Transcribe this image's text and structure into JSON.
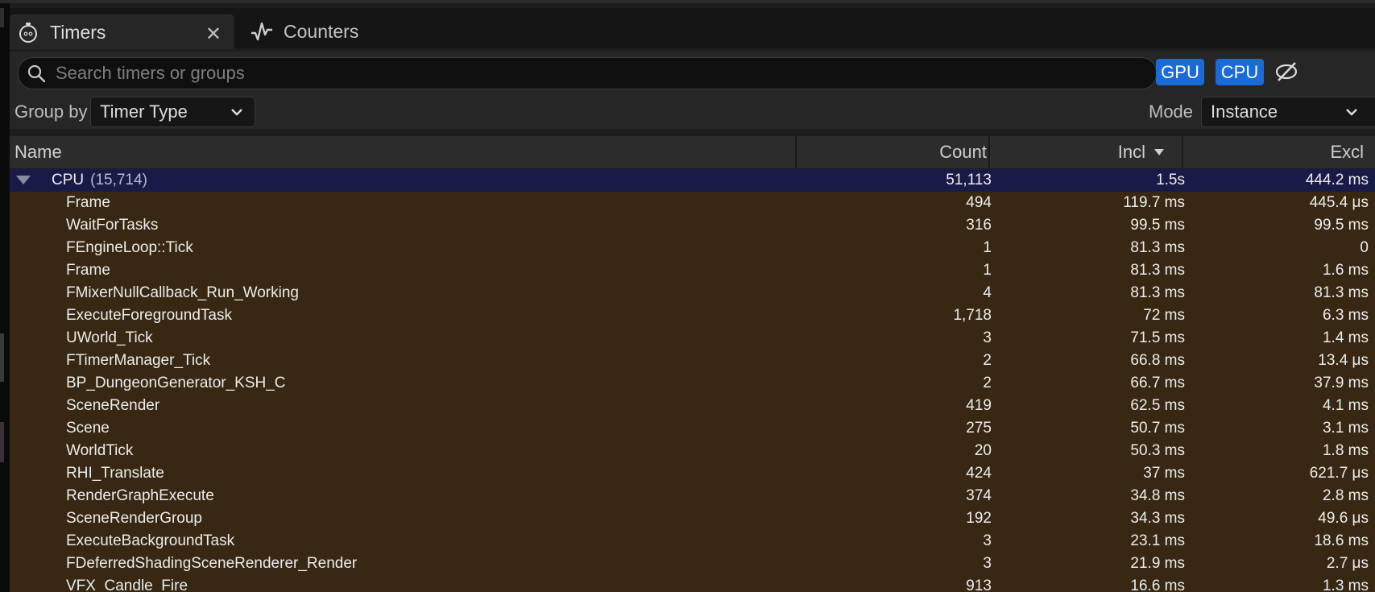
{
  "tabs": [
    {
      "label": "Timers",
      "icon": "stopwatch-icon",
      "active": true
    },
    {
      "label": "Counters",
      "icon": "pulse-icon",
      "active": false
    }
  ],
  "search": {
    "placeholder": "Search timers or groups",
    "value": ""
  },
  "filters": {
    "gpu_label": "GPU",
    "cpu_label": "CPU",
    "accent": "#1a6ad8"
  },
  "group_by": {
    "label": "Group by",
    "value": "Timer Type"
  },
  "mode": {
    "label": "Mode",
    "value": "Instance"
  },
  "columns": {
    "name": "Name",
    "count": "Count",
    "incl": "Incl",
    "excl": "Excl",
    "sort_column": "Incl",
    "sort_order": "descending"
  },
  "group": {
    "name": "CPU",
    "count_label": "(15,714)",
    "count": "51,113",
    "incl": "1.5s",
    "excl": "444.2 ms",
    "expanded": true
  },
  "rows": [
    {
      "name": "Frame",
      "count": "494",
      "incl": "119.7 ms",
      "excl": "445.4 μs"
    },
    {
      "name": "WaitForTasks",
      "count": "316",
      "incl": "99.5 ms",
      "excl": "99.5 ms"
    },
    {
      "name": "FEngineLoop::Tick",
      "count": "1",
      "incl": "81.3 ms",
      "excl": "0"
    },
    {
      "name": "Frame",
      "count": "1",
      "incl": "81.3 ms",
      "excl": "1.6 ms"
    },
    {
      "name": "FMixerNullCallback_Run_Working",
      "count": "4",
      "incl": "81.3 ms",
      "excl": "81.3 ms"
    },
    {
      "name": "ExecuteForegroundTask",
      "count": "1,718",
      "incl": "72 ms",
      "excl": "6.3 ms"
    },
    {
      "name": "UWorld_Tick",
      "count": "3",
      "incl": "71.5 ms",
      "excl": "1.4 ms"
    },
    {
      "name": "FTimerManager_Tick",
      "count": "2",
      "incl": "66.8 ms",
      "excl": "13.4 μs"
    },
    {
      "name": "BP_DungeonGenerator_KSH_C",
      "count": "2",
      "incl": "66.7 ms",
      "excl": "37.9 ms"
    },
    {
      "name": "SceneRender",
      "count": "419",
      "incl": "62.5 ms",
      "excl": "4.1 ms"
    },
    {
      "name": "Scene",
      "count": "275",
      "incl": "50.7 ms",
      "excl": "3.1 ms"
    },
    {
      "name": "WorldTick",
      "count": "20",
      "incl": "50.3 ms",
      "excl": "1.8 ms"
    },
    {
      "name": "RHI_Translate",
      "count": "424",
      "incl": "37 ms",
      "excl": "621.7 μs"
    },
    {
      "name": "RenderGraphExecute",
      "count": "374",
      "incl": "34.8 ms",
      "excl": "2.8 ms"
    },
    {
      "name": "SceneRenderGroup",
      "count": "192",
      "incl": "34.3 ms",
      "excl": "49.6 μs"
    },
    {
      "name": "ExecuteBackgroundTask",
      "count": "3",
      "incl": "23.1 ms",
      "excl": "18.6 ms"
    },
    {
      "name": "FDeferredShadingSceneRenderer_Render",
      "count": "3",
      "incl": "21.9 ms",
      "excl": "2.7 μs"
    },
    {
      "name": "VFX_Candle_Fire",
      "count": "913",
      "incl": "16.6 ms",
      "excl": "1.3 ms"
    }
  ]
}
